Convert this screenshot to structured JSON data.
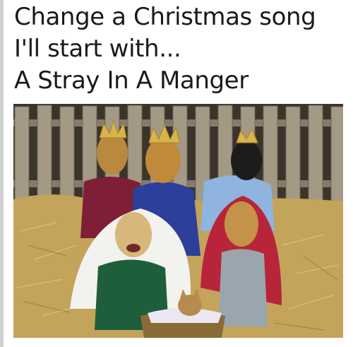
{
  "caption": {
    "line1": "Change a Christmas song",
    "line2": "I'll start with...",
    "line3": "A Stray In A Manger"
  },
  "photo": {
    "subject": "Dogs and cat in nativity costumes on straw",
    "colors": {
      "fence": "#9a9080",
      "straw": "#c9a85a",
      "crown": "#d8b44a",
      "robe_maroon": "#7e1f35",
      "robe_blue": "#2c3f9b",
      "robe_lightblue": "#8fb4e0",
      "robe_green": "#1f5e3a",
      "shawl_red": "#b8243a",
      "veil_white": "#f2f2ee"
    }
  }
}
